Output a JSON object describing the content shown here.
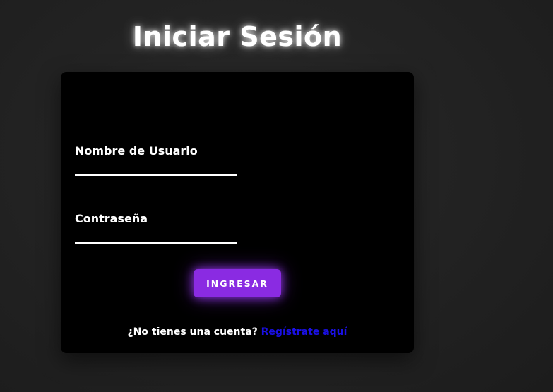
{
  "page": {
    "title": "Iniciar Sesión"
  },
  "form": {
    "username_label": "Nombre de Usuario",
    "username_value": "",
    "password_label": "Contraseña",
    "password_value": "",
    "submit_label": "INGRESAR"
  },
  "footer": {
    "prompt": "¿No tienes una cuenta?",
    "register_link": "Regístrate aquí"
  },
  "colors": {
    "accent": "#8a2be2",
    "link": "#1a10e6",
    "card_background": "#000000",
    "page_background": "#232323"
  }
}
